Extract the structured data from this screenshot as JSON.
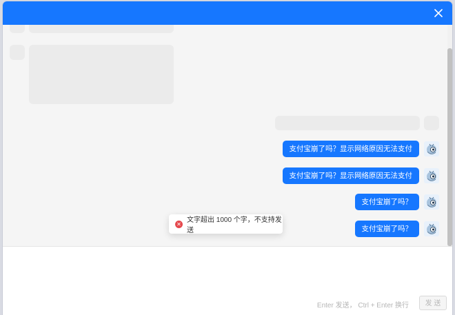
{
  "window": {
    "accent_color": "#1677ff"
  },
  "titlebar": {
    "close_icon": "close-icon"
  },
  "messages": [
    {
      "text": "支付宝崩了吗？显示网络原因无法支付",
      "sender": "self"
    },
    {
      "text": "支付宝崩了吗？显示网络原因无法支付",
      "sender": "self"
    },
    {
      "text": "支付宝崩了吗？",
      "sender": "self"
    },
    {
      "text": "支付宝崩了吗？",
      "sender": "self"
    }
  ],
  "toast": {
    "icon": "error-icon",
    "text": "文字超出 1000 个字，不支持发送",
    "color": "#e5484d"
  },
  "composer": {
    "hint": "Enter 发送， Ctrl + Enter 换行",
    "send_label": "发 送"
  }
}
